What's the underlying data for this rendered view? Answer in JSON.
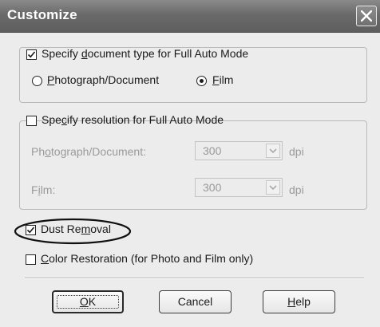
{
  "window": {
    "title": "Customize",
    "close_icon": "close-icon"
  },
  "doc_type_group": {
    "checkbox_label": [
      "Specify ",
      "d",
      "ocument type for Full Auto Mode"
    ],
    "checked": true,
    "options": [
      {
        "label": [
          "",
          "P",
          "hotograph/Document"
        ],
        "selected": false
      },
      {
        "label": [
          "",
          "F",
          "ilm"
        ],
        "selected": true
      }
    ]
  },
  "resolution_group": {
    "checkbox_label": [
      "Spe",
      "c",
      "ify resolution for Full Auto Mode"
    ],
    "checked": false,
    "rows": [
      {
        "label": [
          "Ph",
          "o",
          "tograph/Document:"
        ],
        "value": "300",
        "unit": "dpi"
      },
      {
        "label": [
          "F",
          "i",
          "lm:"
        ],
        "value": "300",
        "unit": "dpi"
      }
    ]
  },
  "dust_removal": {
    "label": [
      "Dust Re",
      "m",
      "oval"
    ],
    "checked": true
  },
  "color_restoration": {
    "label": [
      "",
      "C",
      "olor Restoration (for Photo and Film only)"
    ],
    "checked": false
  },
  "buttons": {
    "ok": [
      "",
      "O",
      "K"
    ],
    "cancel": [
      "Cancel",
      "",
      ""
    ],
    "help": [
      "",
      "H",
      "elp"
    ]
  },
  "colors": {
    "titlebar": "#6a6a6a",
    "dialog_bg": "#ececec",
    "disabled_text": "#9a9a9a"
  }
}
